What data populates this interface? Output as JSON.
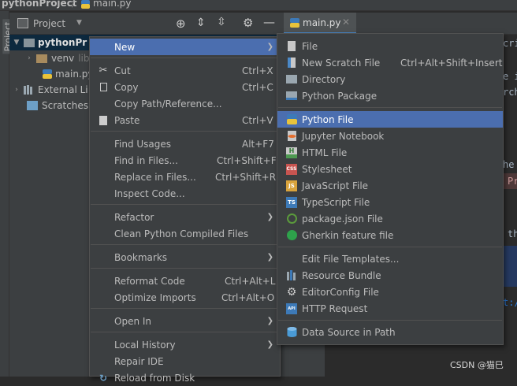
{
  "navbar": {
    "project": "pythonProject",
    "file": "main.py"
  },
  "left_stripe": {
    "label": "Project"
  },
  "project_panel": {
    "title": "Project",
    "tree": [
      {
        "label": "pythonPr",
        "bold": true
      },
      {
        "label": "venv",
        "suffix": "lib"
      },
      {
        "label": "main.py"
      },
      {
        "label": "External Li"
      },
      {
        "label": "Scratches"
      }
    ]
  },
  "editor": {
    "tab_label": "main.py",
    "snippets": [
      "cri",
      "e i",
      "rch",
      "he",
      "Pr",
      "th",
      "t://"
    ]
  },
  "context_menu": {
    "items": [
      {
        "label": "New",
        "shortcut": "",
        "submenu": true,
        "highlight": true
      },
      {
        "label": "Cut",
        "shortcut": "Ctrl+X",
        "icon": "scissors-icon"
      },
      {
        "label": "Copy",
        "shortcut": "Ctrl+C",
        "icon": "copy-icon"
      },
      {
        "label": "Copy Path/Reference...",
        "shortcut": ""
      },
      {
        "label": "Paste",
        "shortcut": "Ctrl+V",
        "icon": "paste-icon"
      },
      {
        "label": "Find Usages",
        "shortcut": "Alt+F7"
      },
      {
        "label": "Find in Files...",
        "shortcut": "Ctrl+Shift+F"
      },
      {
        "label": "Replace in Files...",
        "shortcut": "Ctrl+Shift+R"
      },
      {
        "label": "Inspect Code...",
        "shortcut": ""
      },
      {
        "label": "Refactor",
        "shortcut": "",
        "submenu": true
      },
      {
        "label": "Clean Python Compiled Files",
        "shortcut": ""
      },
      {
        "label": "Bookmarks",
        "shortcut": "",
        "submenu": true
      },
      {
        "label": "Reformat Code",
        "shortcut": "Ctrl+Alt+L"
      },
      {
        "label": "Optimize Imports",
        "shortcut": "Ctrl+Alt+O"
      },
      {
        "label": "Open In",
        "shortcut": "",
        "submenu": true
      },
      {
        "label": "Local History",
        "shortcut": "",
        "submenu": true
      },
      {
        "label": "Repair IDE",
        "shortcut": ""
      },
      {
        "label": "Reload from Disk",
        "shortcut": ""
      }
    ]
  },
  "new_submenu": {
    "items": [
      {
        "label": "File",
        "icon": "file-icon",
        "shortcut": ""
      },
      {
        "label": "New Scratch File",
        "icon": "scratch-file-icon",
        "shortcut": "Ctrl+Alt+Shift+Insert"
      },
      {
        "label": "Directory",
        "icon": "folder-icon",
        "shortcut": ""
      },
      {
        "label": "Python Package",
        "icon": "package-icon",
        "shortcut": ""
      },
      {
        "label": "Python File",
        "icon": "python-icon",
        "shortcut": "",
        "highlight": true
      },
      {
        "label": "Jupyter Notebook",
        "icon": "jupyter-icon",
        "shortcut": ""
      },
      {
        "label": "HTML File",
        "icon": "html-icon",
        "icon_text": "H",
        "shortcut": ""
      },
      {
        "label": "Stylesheet",
        "icon": "css-icon",
        "icon_text": "CSS",
        "shortcut": ""
      },
      {
        "label": "JavaScript File",
        "icon": "js-icon",
        "icon_text": "JS",
        "shortcut": ""
      },
      {
        "label": "TypeScript File",
        "icon": "ts-icon",
        "icon_text": "TS",
        "shortcut": ""
      },
      {
        "label": "package.json File",
        "icon": "npm-icon",
        "shortcut": ""
      },
      {
        "label": "Gherkin feature file",
        "icon": "gherkin-icon",
        "shortcut": ""
      },
      {
        "label": "Edit File Templates...",
        "shortcut": ""
      },
      {
        "label": "Resource Bundle",
        "icon": "resource-bundle-icon",
        "shortcut": ""
      },
      {
        "label": "EditorConfig File",
        "icon": "gear-icon",
        "shortcut": ""
      },
      {
        "label": "HTTP Request",
        "icon": "api-icon",
        "icon_text": "API",
        "shortcut": ""
      },
      {
        "label": "Data Source in Path",
        "icon": "database-icon",
        "shortcut": ""
      }
    ]
  },
  "watermark": "CSDN @猫巳",
  "colors": {
    "highlight": "#4b6eaf",
    "menu_bg": "#3c3f41",
    "editor_bg": "#2b2b2b"
  }
}
